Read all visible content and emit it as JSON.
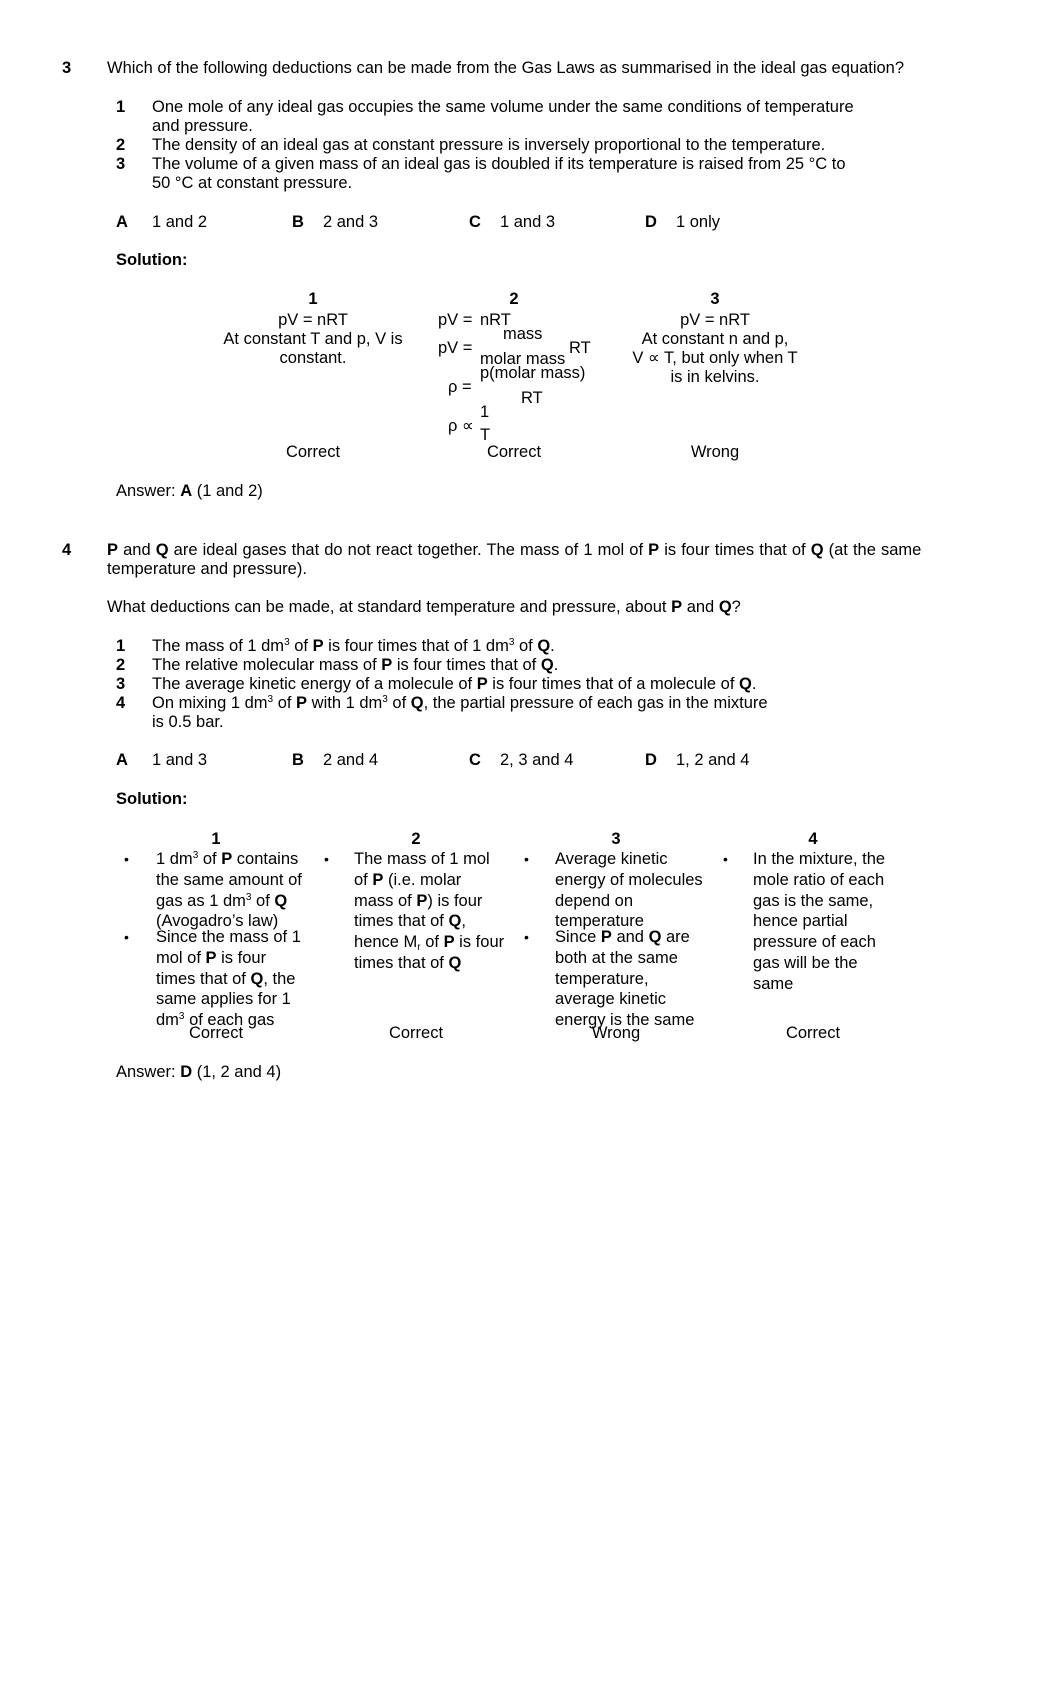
{
  "q3": {
    "number": "3",
    "question": "Which of the following deductions can be made from the Gas Laws as summarised in the ideal gas equation?",
    "statements": [
      {
        "num": "1",
        "line1": "One mole of any ideal gas occupies the same volume under the same conditions of temperature",
        "line2": "and pressure."
      },
      {
        "num": "2",
        "line1": "The density of an ideal gas at constant pressure is inversely proportional to the temperature."
      },
      {
        "num": "3",
        "line1": "The volume of a given mass of an ideal gas is doubled if its temperature is raised from 25 °C to",
        "line2": "50 °C at constant pressure."
      }
    ],
    "options": [
      {
        "letter": "A",
        "text": "1 and 2"
      },
      {
        "letter": "B",
        "text": "2 and 3"
      },
      {
        "letter": "C",
        "text": "1 and 3"
      },
      {
        "letter": "D",
        "text": "1 only"
      }
    ],
    "solution_label": "Solution:",
    "solution": {
      "col1": {
        "num": "1",
        "lines": [
          "pV = nRT",
          "At constant T and p, V is",
          "constant."
        ],
        "verdict": "Correct"
      },
      "col2": {
        "num": "2",
        "eq1_lhs": "pV =",
        "eq1_rhs": "nRT",
        "eq2_lhs": "pV =",
        "eq2_num": "mass",
        "eq2_den": "molar mass",
        "eq2_rt": "RT",
        "eq3_lhs": "ρ =",
        "eq3_num": "p(molar mass)",
        "eq3_den": "RT",
        "eq4_lhs": "ρ ∝",
        "eq4_num": "1",
        "eq4_den": "T",
        "verdict": "Correct"
      },
      "col3": {
        "num": "3",
        "lines": [
          "pV =  nRT",
          "At constant n and p,",
          "V ∝ T, but only when T",
          "is in kelvins."
        ],
        "verdict": "Wrong"
      }
    },
    "answer_prefix": "Answer: ",
    "answer_letter": "A",
    "answer_suffix": " (1 and 2)"
  },
  "q4": {
    "number": "4",
    "intro": {
      "P": "P",
      "Q": "Q",
      "t1": " and ",
      "t2": " are ideal gases that do not react together. The mass of 1 mol of ",
      "t3": " is four times that of ",
      "t4": " (at the same",
      "line2": "temperature and pressure)."
    },
    "prompt": {
      "t1": "What deductions can be made, at standard temperature and pressure, about ",
      "t2": " and ",
      "t3": "?"
    },
    "statements": {
      "s1": {
        "num": "1",
        "a": "The mass of 1 dm",
        "b": " of ",
        "c": " is four times that of 1 dm",
        "d": " of ",
        "e": "."
      },
      "s2": {
        "num": "2",
        "a": "The relative molecular mass of ",
        "b": " is four times that of ",
        "c": "."
      },
      "s3": {
        "num": "3",
        "a": "The average kinetic energy of a molecule of ",
        "b": " is four times that of a molecule of ",
        "c": "."
      },
      "s4": {
        "num": "4",
        "a": "On mixing 1 dm",
        "b": " of ",
        "c": " with 1 dm",
        "d": " of ",
        "e": ", the partial pressure of each gas in the mixture",
        "line2": "is 0.5 bar."
      }
    },
    "sup3": "3",
    "options": [
      {
        "letter": "A",
        "text": "1 and 3"
      },
      {
        "letter": "B",
        "text": "2 and 4"
      },
      {
        "letter": "C",
        "text": "2, 3 and 4"
      },
      {
        "letter": "D",
        "text": "1, 2 and 4"
      }
    ],
    "solution_label": "Solution:",
    "bullet": "•",
    "solution": {
      "col1": {
        "num": "1",
        "verdict": "Correct"
      },
      "col2": {
        "num": "2",
        "verdict": "Correct",
        "sub_r": "r"
      },
      "col3": {
        "num": "3",
        "verdict": "Wrong",
        "b1": [
          "Average kinetic",
          "energy of molecules",
          "depend on",
          "temperature"
        ],
        "b2_l1a": "Since ",
        "b2_l1b": " and ",
        "b2_l1c": " are",
        "b2_rest": [
          "both at the same",
          "temperature,",
          "average kinetic",
          "energy is the same"
        ]
      },
      "col4": {
        "num": "4",
        "verdict": "Correct",
        "b1": [
          "In the mixture, the",
          "mole ratio of each",
          "gas is the same,",
          "hence partial",
          "pressure of each",
          "gas will be the",
          "same"
        ]
      }
    },
    "answer_prefix": "Answer: ",
    "answer_letter": "D",
    "answer_suffix": " (1, 2 and 4)"
  }
}
